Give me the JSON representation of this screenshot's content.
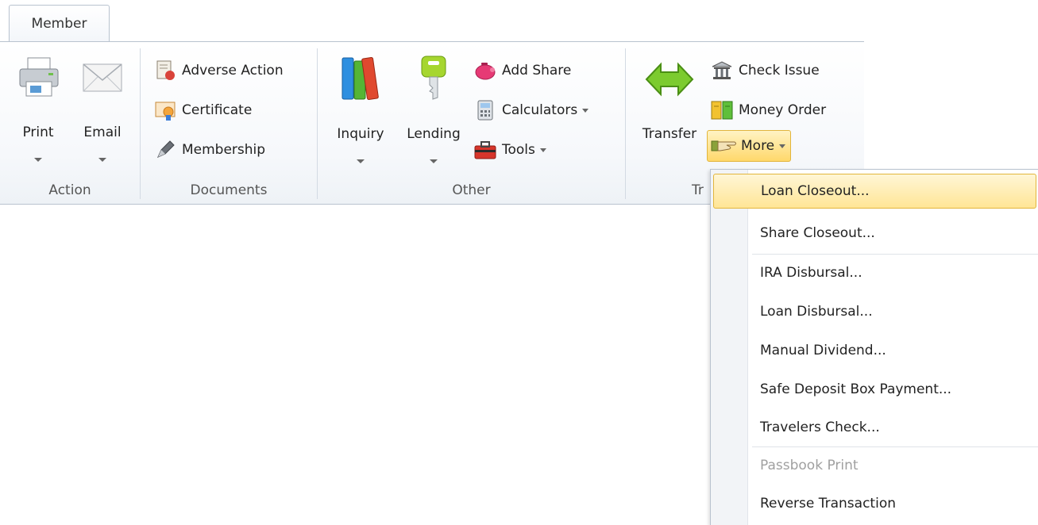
{
  "tab": {
    "label": "Member"
  },
  "groups": {
    "action": {
      "label": "Action",
      "print": "Print",
      "email": "Email"
    },
    "documents": {
      "label": "Documents",
      "adverse": "Adverse Action",
      "certificate": "Certificate",
      "membership": "Membership"
    },
    "other": {
      "label": "Other",
      "inquiry": "Inquiry",
      "lending": "Lending",
      "add_share": "Add Share",
      "calculators": "Calculators",
      "tools": "Tools"
    },
    "transfer": {
      "label": "Tr",
      "transfer": "Transfer",
      "check_issue": "Check Issue",
      "money_order": "Money Order",
      "more": "More"
    }
  },
  "menu": {
    "items": [
      "Loan Closeout...",
      "Share Closeout...",
      "IRA Disbursal...",
      "Loan Disbursal...",
      "Manual Dividend...",
      "Safe Deposit Box Payment...",
      "Travelers Check...",
      "Passbook Print",
      "Reverse Transaction"
    ]
  },
  "colors": {
    "highlight": "#ffe596",
    "highlight_border": "#e2b53c",
    "ribbon_border": "#b9c3cf",
    "disabled_text": "#a0a0a0"
  }
}
